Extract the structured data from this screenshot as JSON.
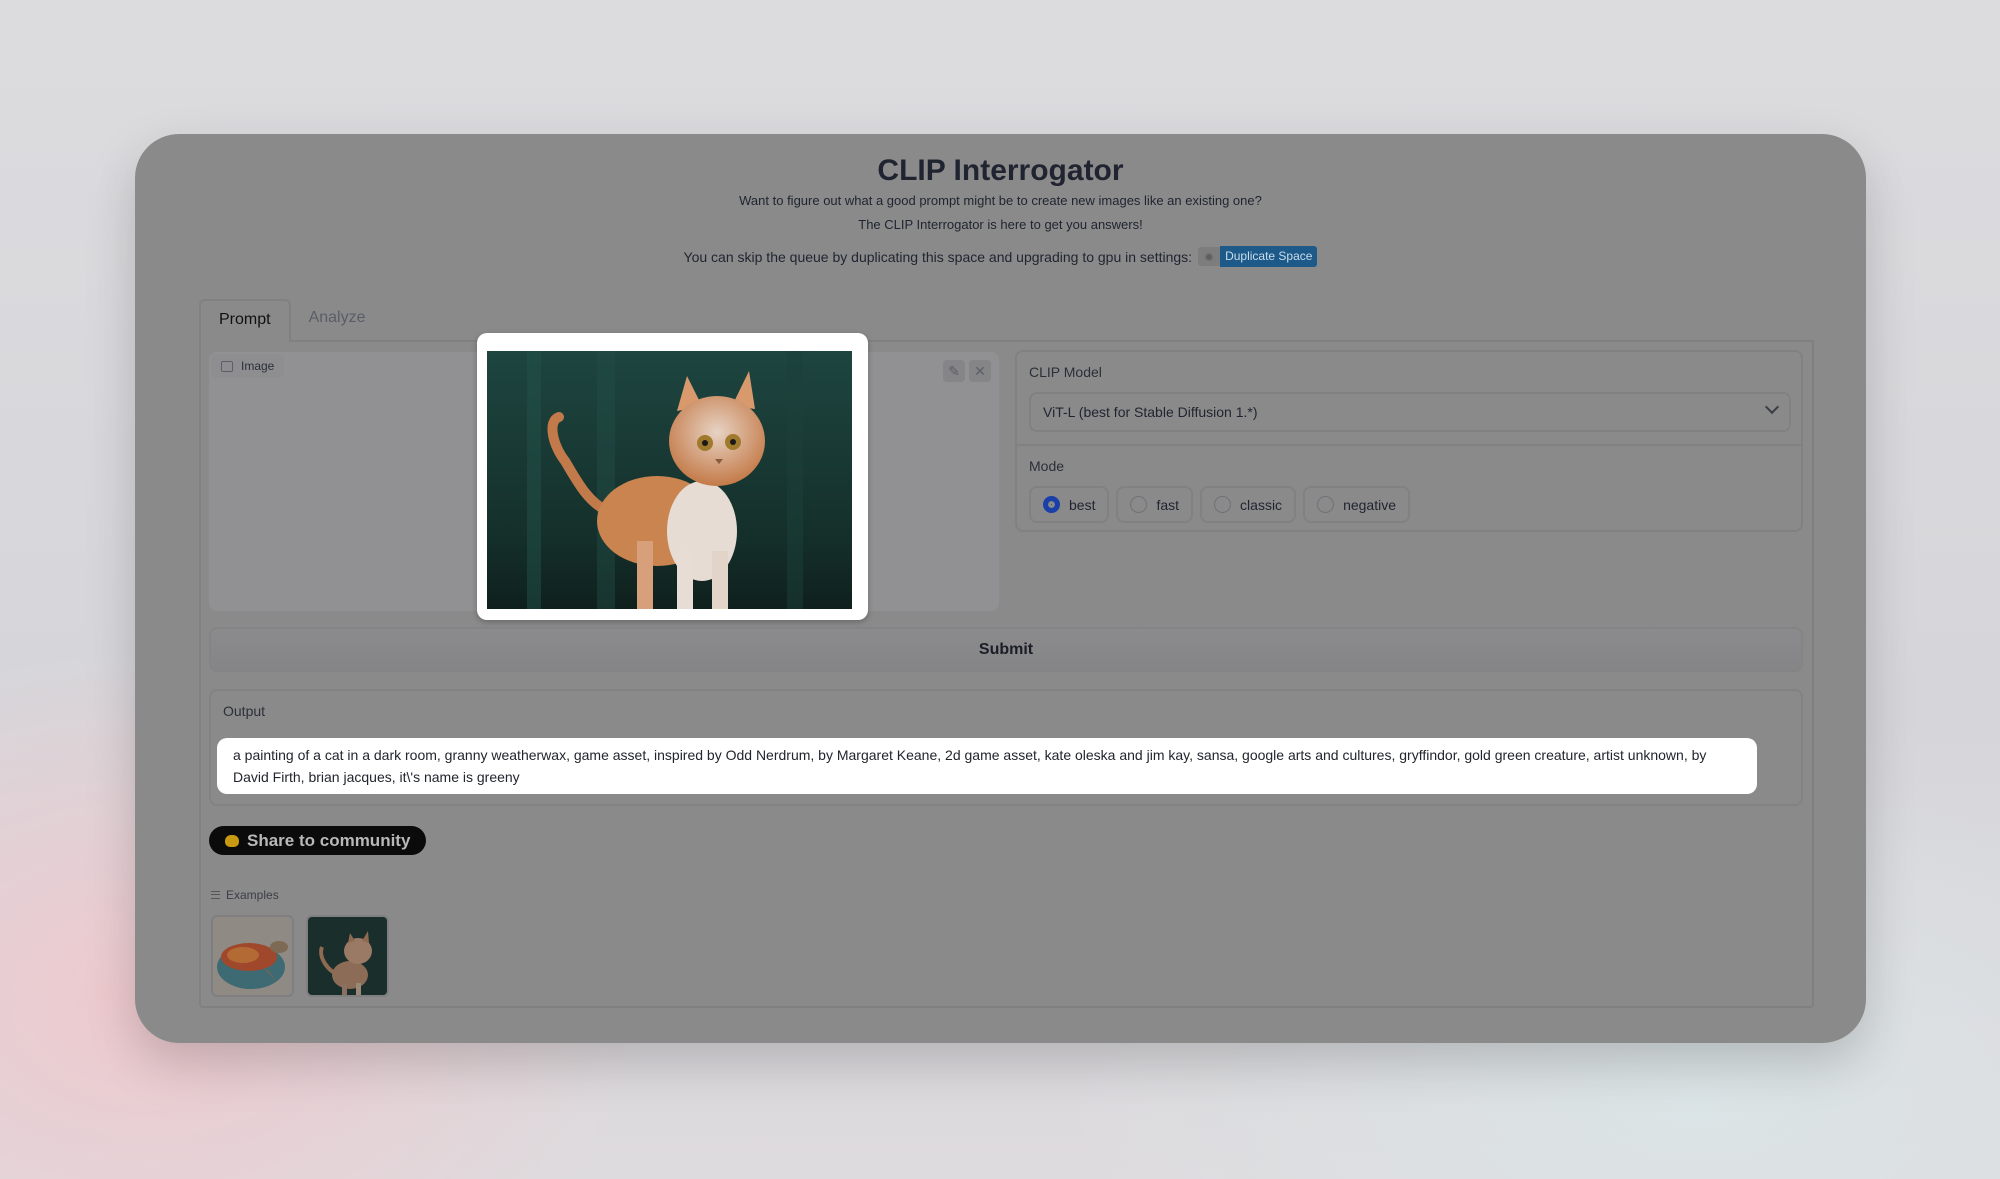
{
  "header": {
    "title": "CLIP Interrogator",
    "subtitle_line1": "Want to figure out what a good prompt might be to create new images like an existing one?",
    "subtitle_line2": "The CLIP Interrogator is here to get you answers!",
    "queue_text": "You can skip the queue by duplicating this space and upgrading to gpu in settings:",
    "duplicate_label": "Duplicate Space",
    "duplicate_color": "#1d5a8a"
  },
  "tabs": [
    {
      "label": "Prompt",
      "active": true
    },
    {
      "label": "Analyze",
      "active": false
    }
  ],
  "image_input": {
    "label": "Image",
    "icon": "image-icon",
    "tools": [
      "edit-icon",
      "close-icon"
    ],
    "preview_subject": "painting of an orange and white cat on dark green background"
  },
  "settings": {
    "clip_model_label": "CLIP Model",
    "clip_model_value": "ViT-L (best for Stable Diffusion 1.*)",
    "mode_label": "Mode",
    "modes": [
      {
        "label": "best",
        "selected": true
      },
      {
        "label": "fast",
        "selected": false
      },
      {
        "label": "classic",
        "selected": false
      },
      {
        "label": "negative",
        "selected": false
      }
    ],
    "accent": "#1b3fa8"
  },
  "submit_label": "Submit",
  "output": {
    "label": "Output",
    "text": "a painting of a cat in a dark room, granny weatherwax, game asset, inspired by Odd Nerdrum, by Margaret Keane, 2d game asset, kate oleska and jim kay, sansa, google arts and cultures, gryffindor, gold green creature, artist unknown, by David Firth, brian jacques, it\\'s name is greeny"
  },
  "share_label": "Share to community",
  "examples": {
    "label": "Examples",
    "items": [
      {
        "name": "sea-turtle-painting"
      },
      {
        "name": "cat-painting"
      }
    ]
  }
}
